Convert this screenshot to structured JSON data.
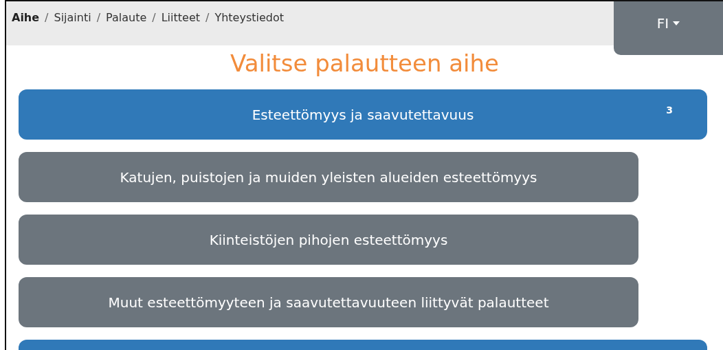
{
  "breadcrumb": [
    {
      "label": "Aihe",
      "selected": true
    },
    {
      "label": "Sijainti",
      "selected": false
    },
    {
      "label": "Palaute",
      "selected": false
    },
    {
      "label": "Liitteet",
      "selected": false
    },
    {
      "label": "Yhteystiedot",
      "selected": false
    }
  ],
  "breadcrumb_separator": "/",
  "language": {
    "label": "FI"
  },
  "title": "Valitse palautteen aihe",
  "topics": [
    {
      "kind": "category",
      "label": "Esteettömyys ja saavutettavuus",
      "count": "3"
    },
    {
      "kind": "subtopic",
      "label": "Katujen, puistojen ja muiden yleisten alueiden esteettömyys"
    },
    {
      "kind": "subtopic",
      "label": "Kiinteistöjen pihojen esteettömyys"
    },
    {
      "kind": "subtopic",
      "label": "Muut esteettömyyteen ja saavutettavuuteen liittyvät palautteet"
    },
    {
      "kind": "category"
    }
  ]
}
